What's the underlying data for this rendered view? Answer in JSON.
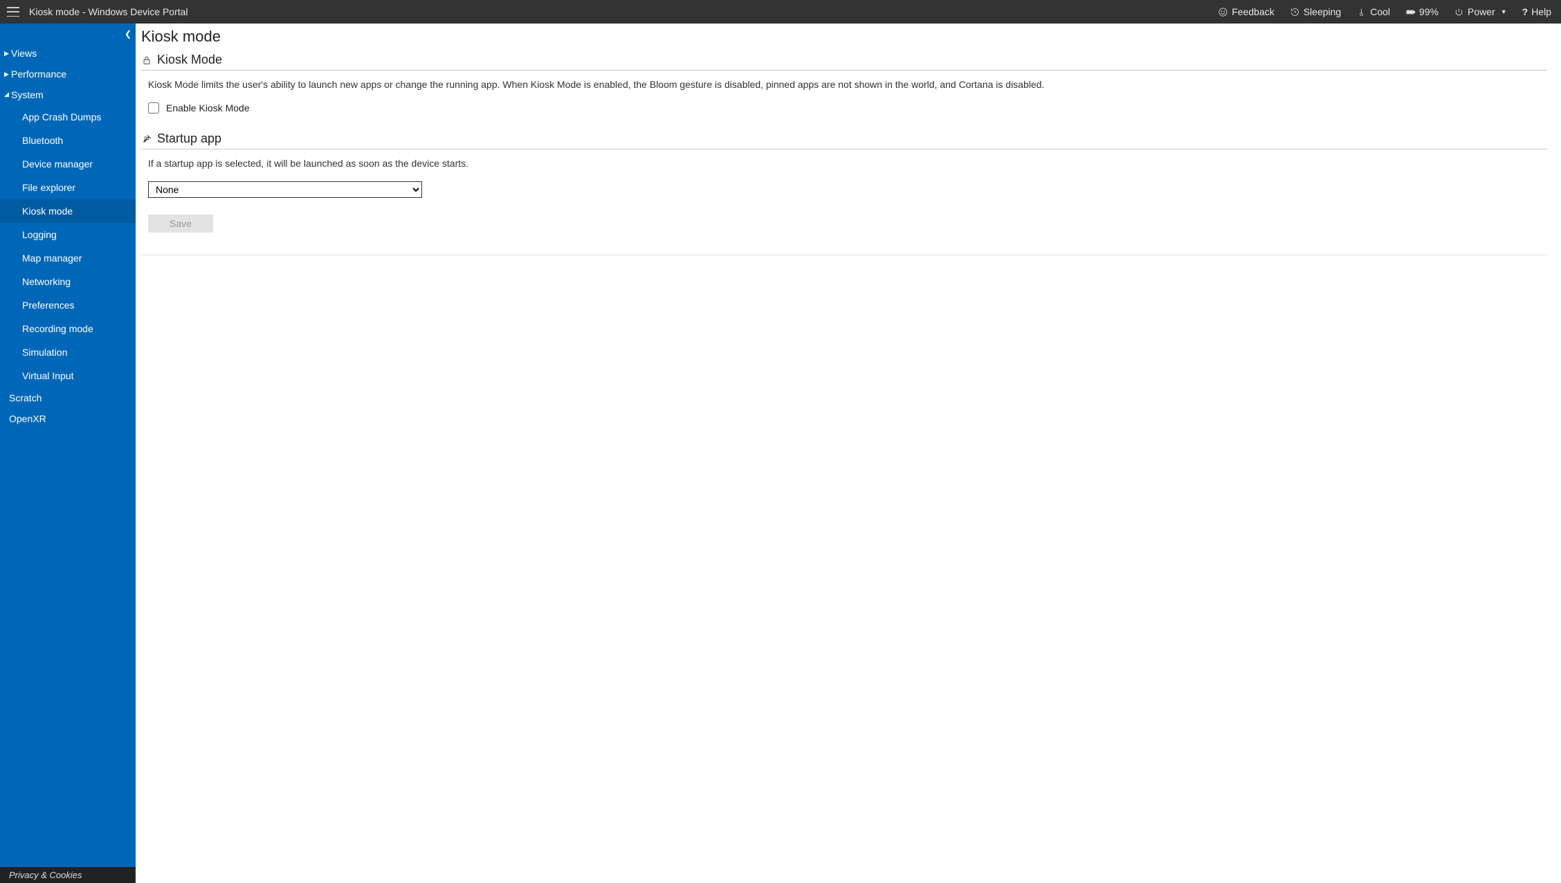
{
  "topbar": {
    "title": "Kiosk mode - Windows Device Portal",
    "feedback": "Feedback",
    "sleeping": "Sleeping",
    "cool": "Cool",
    "battery": "99%",
    "power": "Power",
    "help": "Help"
  },
  "sidebar": {
    "sections": [
      {
        "label": "Views",
        "expanded": false
      },
      {
        "label": "Performance",
        "expanded": false
      },
      {
        "label": "System",
        "expanded": true,
        "items": [
          "App Crash Dumps",
          "Bluetooth",
          "Device manager",
          "File explorer",
          "Kiosk mode",
          "Logging",
          "Map manager",
          "Networking",
          "Preferences",
          "Recording mode",
          "Simulation",
          "Virtual Input"
        ],
        "active_index": 4
      }
    ],
    "plain": [
      "Scratch",
      "OpenXR"
    ],
    "footer": "Privacy & Cookies"
  },
  "main": {
    "page_title": "Kiosk mode",
    "kiosk": {
      "heading": "Kiosk Mode",
      "desc": "Kiosk Mode limits the user's ability to launch new apps or change the running app. When Kiosk Mode is enabled, the Bloom gesture is disabled, pinned apps are not shown in the world, and Cortana is disabled.",
      "checkbox_label": "Enable Kiosk Mode",
      "checked": false
    },
    "startup": {
      "heading": "Startup app",
      "desc": "If a startup app is selected, it will be launched as soon as the device starts.",
      "selected": "None",
      "save_label": "Save"
    }
  }
}
